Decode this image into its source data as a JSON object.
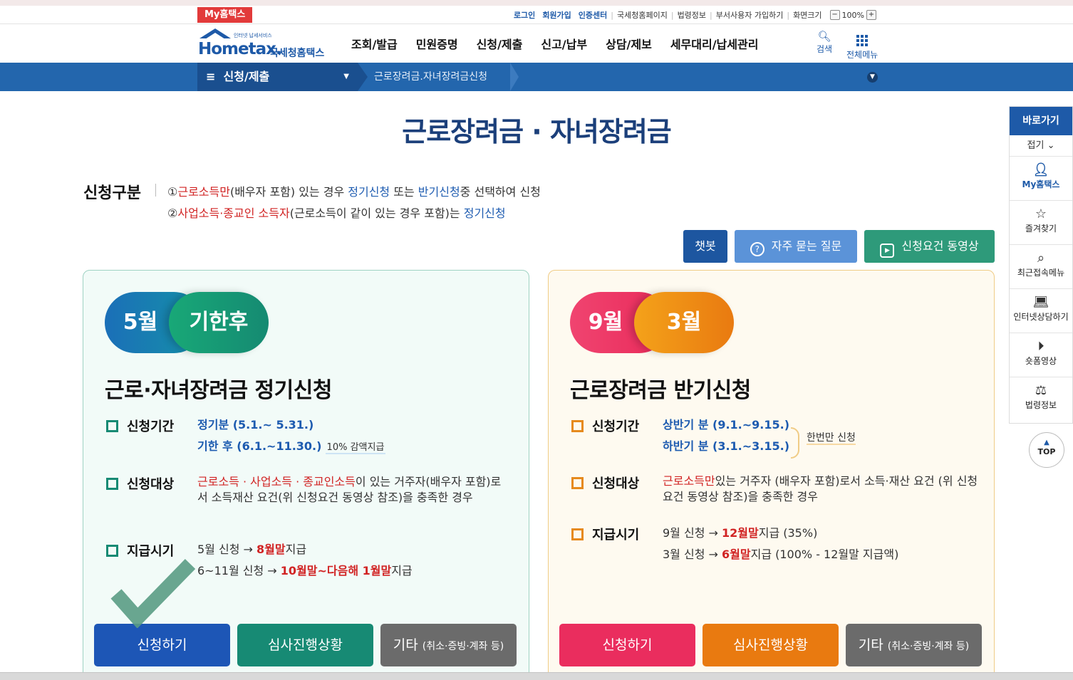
{
  "util": {
    "my_tab": "My홈택스",
    "links": [
      "로그인",
      "회원가입",
      "인증센터",
      "국세청홈페이지",
      "법령정보",
      "부서사용자 가입하기",
      "화면크기"
    ],
    "zoom_minus": "−",
    "zoom_value": "100%",
    "zoom_plus": "+"
  },
  "header": {
    "logo_small": "인터넷 납세서비스",
    "logo_home": "Hometax.",
    "logo_ko": "국세청홈택스",
    "gnb": [
      "조회/발급",
      "민원증명",
      "신청/제출",
      "신고/납부",
      "상담/제보",
      "세무대리/납세관리"
    ],
    "search_label": "검색",
    "allmenu_label": "전체메뉴"
  },
  "nav": {
    "menu_label": "신청/제출",
    "breadcrumb": "근로장려금.자녀장려금신청"
  },
  "page": {
    "title": "근로장려금 · 자녀장려금",
    "type_label": "신청구분",
    "type_lines": [
      {
        "num": "①",
        "red": "근로소득만",
        "t1": "(배우자 포함) 있는 경우 ",
        "b1": "정기신청",
        "t2": " 또는 ",
        "b2": "반기신청",
        "t3": "중 선택하여 신청"
      },
      {
        "num": "②",
        "red": "사업소득·종교인 소득자",
        "t1": "(근로소득이 같이 있는 경우 포함)는 ",
        "b1": "정기신청"
      }
    ]
  },
  "actions": {
    "chatbot": "챗봇",
    "faq": "자주 묻는 질문",
    "video": "신청요건 동영상"
  },
  "left_card": {
    "pill_1": "5월",
    "pill_2": "기한후",
    "title": "근로·자녀장려금 정기신청",
    "period_label": "신청기간",
    "period_1": "정기분 (5.1.~ 5.31.)",
    "period_2": "기한 후 (6.1.~11.30.)",
    "period_note": "10% 감액지급",
    "target_label": "신청대상",
    "target_red": "근로소득 · 사업소득 · 종교인소득",
    "target_text": "이 있는 거주자(배우자 포함)로서 소득재산 요건(위 신청요건 동영상 참조)을 충족한 경우",
    "pay_label": "지급시기",
    "pay_1_a": "5월 신청 → ",
    "pay_1_red": "8월말",
    "pay_1_b": "지급",
    "pay_2_a": "6~11월 신청 → ",
    "pay_2_red1": "10월말~다음해 1월말",
    "pay_2_b": "지급",
    "btn_apply": "신청하기",
    "btn_status": "심사진행상황",
    "btn_etc": "기타",
    "btn_etc_sub": "(취소·증빙·계좌 등)"
  },
  "right_card": {
    "pill_1": "9월",
    "pill_2": "3월",
    "title": "근로장려금 반기신청",
    "period_label": "신청기간",
    "period_1": "상반기 분 (9.1.~9.15.)",
    "period_2": "하반기 분 (3.1.~3.15.)",
    "period_note": "한번만 신청",
    "target_label": "신청대상",
    "target_red": "근로소득만",
    "target_text": "있는 거주자 (배우자 포함)로서 소득·재산 요건 (위 신청요건 동영상 참조)을 충족한 경우",
    "pay_label": "지급시기",
    "pay_1_a": "9월 신청 → ",
    "pay_1_red": "12월말",
    "pay_1_b": "지급 (35%)",
    "pay_2_a": "3월 신청 → ",
    "pay_2_red": "6월말",
    "pay_2_b": "지급 (100% - 12월말 지급액)",
    "btn_apply": "신청하기",
    "btn_status": "심사진행상황",
    "btn_etc": "기타",
    "btn_etc_sub": "(취소·증빙·계좌 등)"
  },
  "quick": {
    "head": "바로가기",
    "fold": "접기 ⌄",
    "items": [
      "My홈택스",
      "즐겨찾기",
      "최근접속메뉴",
      "인터넷상담하기",
      "숏폼영상",
      "법령정보"
    ],
    "top": "TOP"
  },
  "colors": {
    "brand_blue": "#1e5aa8",
    "nav_blue": "#2366ad",
    "teal": "#178a74",
    "orange": "#e97a10",
    "pink": "#ea2d5e",
    "gray": "#6b6b6b"
  }
}
